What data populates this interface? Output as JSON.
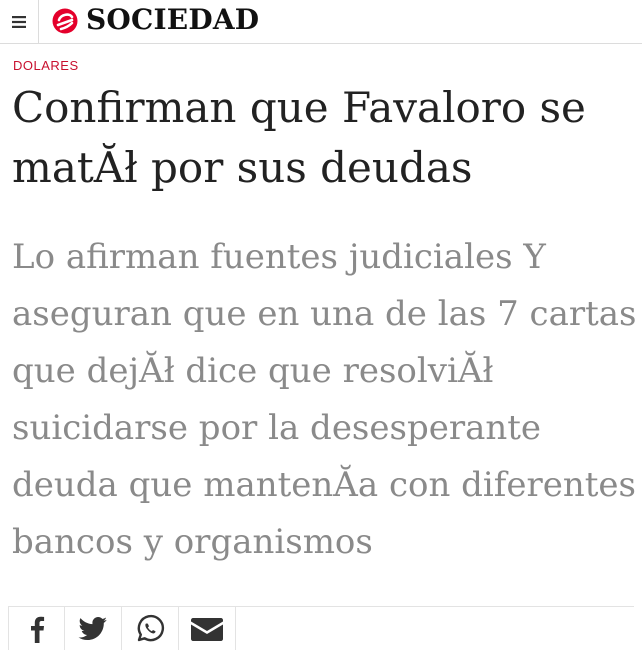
{
  "header": {
    "section_title": "SOCIEDAD",
    "menu_icon": "hamburger-menu-icon",
    "logo_icon": "site-logo-icon",
    "accent_color": "#e4002b"
  },
  "article": {
    "category": "DOLARES",
    "headline": "Confirman que Favaloro se matĂł por sus deudas",
    "subheadline": "Lo afirman fuentes judiciales Y aseguran que en una de las 7 cartas que dejĂł dice que resolviĂł suicidarse por la desesperante deuda que mantenĂ­a con diferentes bancos y organismos"
  },
  "share": {
    "buttons": [
      {
        "icon": "facebook-icon"
      },
      {
        "icon": "twitter-icon"
      },
      {
        "icon": "whatsapp-icon"
      },
      {
        "icon": "email-icon"
      }
    ]
  }
}
